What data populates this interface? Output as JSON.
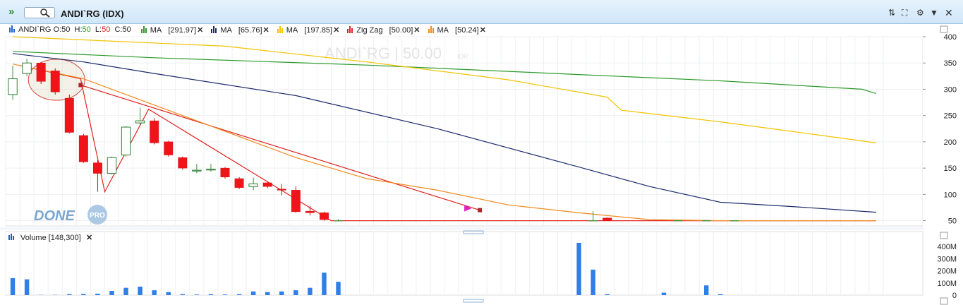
{
  "window": {
    "symbol_input": "",
    "title": "ANDI`RG (IDX)"
  },
  "toolbar_icons": [
    "sort-icon",
    "fullscreen-icon",
    "dropdown-icon",
    "close-icon"
  ],
  "legend": {
    "ohlc": {
      "name": "ANDI`RG",
      "o_label": "O:",
      "o": "50",
      "h_label": "H:",
      "h": "50",
      "l_label": "L:",
      "l": "50",
      "c_label": "C:",
      "c": "50"
    },
    "indicators": [
      {
        "label": "MA",
        "value": "[291.97]",
        "color": "#2a9a2a"
      },
      {
        "label": "MA",
        "value": "[65.76]",
        "color": "#1c2a6b"
      },
      {
        "label": "MA",
        "value": "[197.85]",
        "color": "#f3c300"
      },
      {
        "label": "Zig Zag",
        "value": "[50.00]",
        "color": "#e0221e"
      },
      {
        "label": "MA",
        "value": "[50.24]",
        "color": "#f08a1c"
      }
    ]
  },
  "watermark": {
    "text": "ANDI`RG | 50.00",
    "unit": "IDR"
  },
  "logo": {
    "text": "DONE",
    "badge": "PRO"
  },
  "volume_legend": {
    "label": "Volume",
    "value": "[148,300]"
  },
  "chart_data": [
    {
      "type": "candlestick",
      "symbol": "ANDI`RG",
      "ylim": [
        40,
        400
      ],
      "yticks": [
        50,
        100,
        150,
        200,
        250,
        300,
        350,
        400
      ],
      "n_periods": 62,
      "candles": [
        {
          "o": 290,
          "h": 345,
          "l": 280,
          "c": 320
        },
        {
          "o": 330,
          "h": 358,
          "l": 325,
          "c": 350
        },
        {
          "o": 350,
          "h": 352,
          "l": 310,
          "c": 315
        },
        {
          "o": 335,
          "h": 340,
          "l": 290,
          "c": 295
        },
        {
          "o": 283,
          "h": 290,
          "l": 216,
          "c": 218
        },
        {
          "o": 212,
          "h": 215,
          "l": 160,
          "c": 162
        },
        {
          "o": 160,
          "h": 165,
          "l": 105,
          "c": 140
        },
        {
          "o": 140,
          "h": 172,
          "l": 138,
          "c": 170
        },
        {
          "o": 175,
          "h": 230,
          "l": 172,
          "c": 228
        },
        {
          "o": 236,
          "h": 265,
          "l": 232,
          "c": 240
        },
        {
          "o": 240,
          "h": 245,
          "l": 195,
          "c": 198
        },
        {
          "o": 200,
          "h": 202,
          "l": 172,
          "c": 175
        },
        {
          "o": 170,
          "h": 172,
          "l": 147,
          "c": 150
        },
        {
          "o": 145,
          "h": 158,
          "l": 140,
          "c": 146
        },
        {
          "o": 147,
          "h": 158,
          "l": 143,
          "c": 148
        },
        {
          "o": 150,
          "h": 152,
          "l": 130,
          "c": 133
        },
        {
          "o": 130,
          "h": 133,
          "l": 110,
          "c": 113
        },
        {
          "o": 115,
          "h": 132,
          "l": 108,
          "c": 120
        },
        {
          "o": 122,
          "h": 125,
          "l": 112,
          "c": 115
        },
        {
          "o": 110,
          "h": 120,
          "l": 98,
          "c": 108
        },
        {
          "o": 108,
          "h": 115,
          "l": 65,
          "c": 67
        },
        {
          "o": 68,
          "h": 78,
          "l": 60,
          "c": 65
        },
        {
          "o": 65,
          "h": 67,
          "l": 50,
          "c": 52
        },
        {
          "o": 50,
          "h": 53,
          "l": 50,
          "c": 50
        },
        null,
        null,
        null,
        null,
        null,
        null,
        null,
        null,
        null,
        null,
        null,
        null,
        null,
        null,
        null,
        null,
        null,
        {
          "o": 50,
          "h": 68,
          "l": 50,
          "c": 50
        },
        {
          "o": 55,
          "h": 56,
          "l": 50,
          "c": 50
        },
        null,
        null,
        null,
        null,
        {
          "o": 50,
          "h": 50,
          "l": 50,
          "c": 50
        },
        null,
        {
          "o": 50,
          "h": 51,
          "l": 50,
          "c": 50
        },
        null,
        {
          "o": 50,
          "h": 50,
          "l": 50,
          "c": 50
        },
        null,
        null,
        null,
        null,
        null,
        null,
        null,
        null,
        null,
        null,
        null,
        null,
        null,
        null,
        null,
        null,
        null,
        null,
        null
      ],
      "series": [
        {
          "name": "MA [291.97]",
          "color": "#2a9a2a",
          "points": [
            [
              0,
              372
            ],
            [
              10,
              360
            ],
            [
              25,
              346
            ],
            [
              40,
              328
            ],
            [
              50,
              316
            ],
            [
              60,
              300
            ],
            [
              61,
              292
            ]
          ]
        },
        {
          "name": "MA [65.76]",
          "color": "#1c2a6b",
          "points": [
            [
              0,
              368
            ],
            [
              5,
              352
            ],
            [
              10,
              330
            ],
            [
              20,
              288
            ],
            [
              30,
              225
            ],
            [
              40,
              152
            ],
            [
              45,
              115
            ],
            [
              50,
              85
            ],
            [
              55,
              77
            ],
            [
              61,
              66
            ]
          ]
        },
        {
          "name": "MA [197.85]",
          "color": "#f3c300",
          "points": [
            [
              0,
              400
            ],
            [
              15,
              382
            ],
            [
              25,
              352
            ],
            [
              35,
              318
            ],
            [
              42,
              285
            ],
            [
              43,
              260
            ],
            [
              50,
              238
            ],
            [
              55,
              220
            ],
            [
              61,
              198
            ]
          ]
        },
        {
          "name": "Zig Zag [50.00]",
          "color": "#e0221e",
          "points": [
            [
              0.5,
              345
            ],
            [
              4.8,
              320
            ],
            [
              6.5,
              105
            ],
            [
              9.6,
              262
            ],
            [
              22.5,
              50
            ],
            [
              61,
              50
            ]
          ]
        },
        {
          "name": "Zig Zag projection",
          "color": "#e0221e",
          "points": [
            [
              4.8,
              308
            ],
            [
              33,
              70
            ]
          ]
        },
        {
          "name": "MA [50.24]",
          "color": "#f08a1c",
          "points": [
            [
              0,
              348
            ],
            [
              5,
              320
            ],
            [
              10,
              270
            ],
            [
              15,
              220
            ],
            [
              20,
              170
            ],
            [
              25,
              130
            ],
            [
              30,
              108
            ],
            [
              35,
              80
            ],
            [
              40,
              65
            ],
            [
              45,
              52
            ],
            [
              50,
              50
            ],
            [
              61,
              50
            ]
          ]
        }
      ]
    },
    {
      "type": "bar",
      "name": "Volume",
      "ylim": [
        0,
        430
      ],
      "yticks": [
        0,
        100,
        200,
        300,
        400
      ],
      "ytick_labels": [
        "0",
        "100M",
        "200M",
        "300M",
        "400M"
      ],
      "values": [
        140,
        130,
        2,
        2,
        8,
        10,
        12,
        35,
        60,
        70,
        40,
        25,
        8,
        5,
        8,
        5,
        8,
        30,
        25,
        30,
        40,
        60,
        185,
        110,
        0,
        0,
        0,
        0,
        0,
        0,
        0,
        0,
        0,
        0,
        0,
        0,
        0,
        0,
        0,
        0,
        430,
        210,
        8,
        0,
        0,
        0,
        20,
        0,
        0,
        80,
        8,
        0,
        0,
        0,
        0,
        0,
        0,
        0,
        0,
        0,
        0,
        0
      ],
      "up_color": "#2f7fe8"
    }
  ]
}
